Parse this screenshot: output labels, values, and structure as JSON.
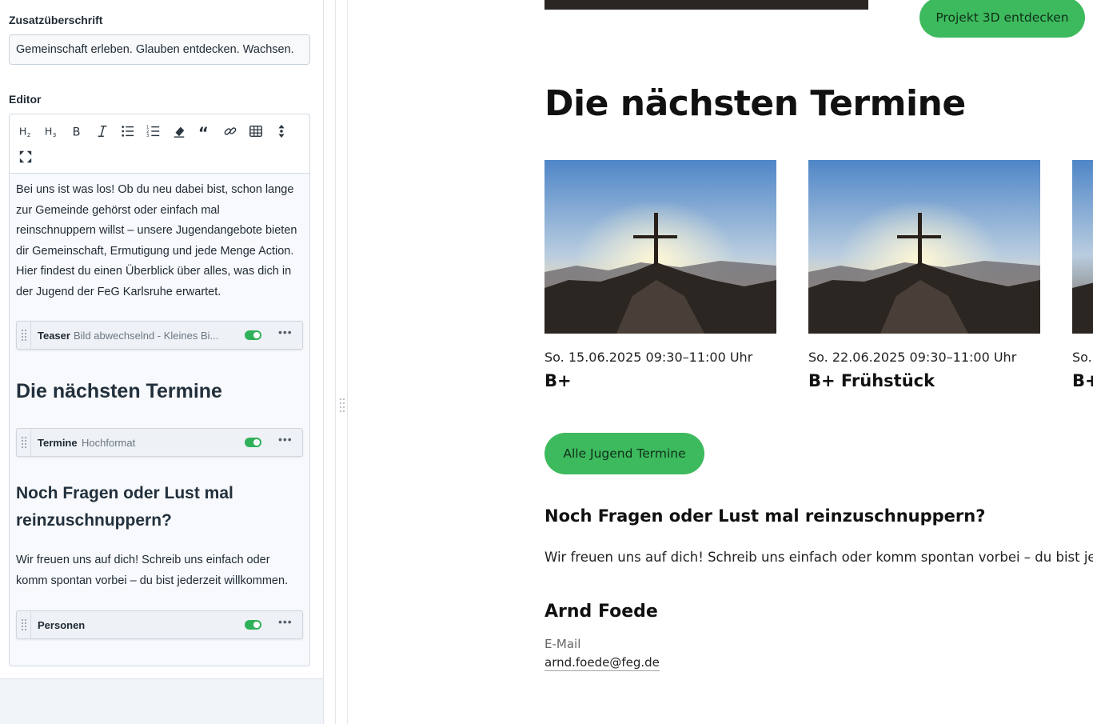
{
  "editor_panel": {
    "subheading_label": "Zusatzüberschrift",
    "subheading_value": "Gemeinschaft erleben. Glauben entdecken. Wachsen.",
    "editor_label": "Editor",
    "toolbar_icons": [
      "heading-2-icon",
      "heading-3-icon",
      "bold-icon",
      "italic-icon",
      "bullet-list-icon",
      "numbered-list-icon",
      "eraser-icon",
      "quote-icon",
      "link-icon",
      "table-icon",
      "move-vertical-icon",
      "fullscreen-icon"
    ],
    "intro_text": "Bei uns ist was los! Ob du neu dabei bist, schon lange zur Gemeinde gehörst oder einfach mal reinschnuppern willst – unsere Jugendangebote bieten dir Gemeinschaft, Ermutigung und jede Menge Action. Hier findest du einen Überblick über alles, was dich in der Jugend der FeG Karlsruhe erwartet.",
    "block_teaser": {
      "title": "Teaser",
      "subtitle": "Bild abwechselnd - Kleines Bi..."
    },
    "heading_termine": "Die nächsten Termine",
    "block_termine": {
      "title": "Termine",
      "subtitle": "Hochformat"
    },
    "heading_fragen": "Noch Fragen oder Lust mal reinzuschnuppern?",
    "fragen_text": "Wir freuen uns auf dich! Schreib uns einfach oder komm spontan vorbei – du bist jederzeit willkommen.",
    "block_personen": {
      "title": "Personen",
      "subtitle": ""
    }
  },
  "preview": {
    "project_button": "Projekt 3D entdecken",
    "events_heading": "Die nächsten Termine",
    "events": [
      {
        "date": "So. 15.06.2025 09:30–11:00 Uhr",
        "title": "B+"
      },
      {
        "date": "So. 22.06.2025 09:30–11:00 Uhr",
        "title": "B+ Frühstück"
      },
      {
        "date": "So.",
        "title": "B+"
      }
    ],
    "all_events_button": "Alle Jugend Termine",
    "questions_heading": "Noch Fragen oder Lust mal reinzuschnuppern?",
    "questions_text": "Wir freuen uns auf dich! Schreib uns einfach oder komm spontan vorbei – du bist je",
    "person_name": "Arnd Foede",
    "email_label": "E-Mail",
    "email_value": "arnd.foede@feg.de"
  },
  "colors": {
    "accent_green": "#3dba5d",
    "toggle_green": "#2fb15a",
    "text_dark": "#1f2a33"
  }
}
